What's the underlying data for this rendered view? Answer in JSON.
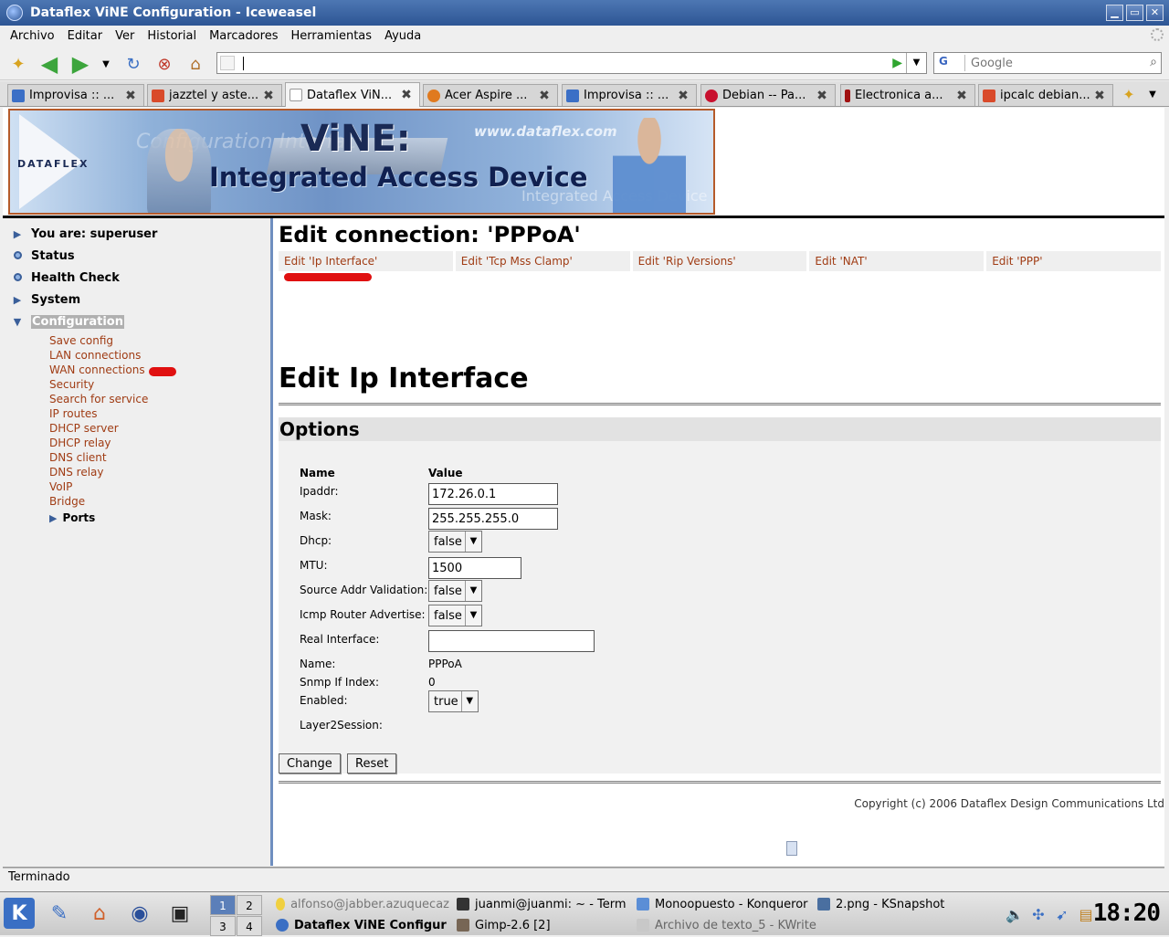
{
  "window": {
    "title": "Dataflex ViNE Configuration - Iceweasel",
    "btn_min": "▁",
    "btn_max": "▭",
    "btn_close": "✕"
  },
  "menu": [
    "Archivo",
    "Editar",
    "Ver",
    "Historial",
    "Marcadores",
    "Herramientas",
    "Ayuda"
  ],
  "toolbar": {
    "url_value": "",
    "search_engine": "G",
    "search_placeholder": "Google"
  },
  "tabs": [
    {
      "label": "Improvisa :: ...",
      "favicon_color": "#3b6fc6",
      "active": false
    },
    {
      "label": "jazztel y aste...",
      "favicon_color": "#d94a2a",
      "active": false
    },
    {
      "label": "Dataflex ViN...",
      "favicon_color": "#ffffff",
      "active": true
    },
    {
      "label": "Acer Aspire ...",
      "favicon_color": "#e07a1f",
      "active": false
    },
    {
      "label": "Improvisa :: ...",
      "favicon_color": "#3b6fc6",
      "active": false
    },
    {
      "label": "Debian -- Pa...",
      "favicon_color": "#c8102e",
      "active": false
    },
    {
      "label": "Electronica a...",
      "favicon_color": "#a01010",
      "active": false
    },
    {
      "label": "ipcalc debian...",
      "favicon_color": "#d94a2a",
      "active": false
    }
  ],
  "banner": {
    "logo": "DATAFLEX",
    "product": "ViNE:",
    "tagline": "Integrated Access Device",
    "url": "www.dataflex.com",
    "ghost1": "Configuration Interface",
    "ghost2": "Integrated Access Device"
  },
  "sidebar": {
    "main": [
      {
        "label": "You are: superuser",
        "marker": "arrow"
      },
      {
        "label": "Status",
        "marker": "dot"
      },
      {
        "label": "Health Check",
        "marker": "dot"
      },
      {
        "label": "System",
        "marker": "arrow"
      },
      {
        "label": "Configuration",
        "marker": "down"
      }
    ],
    "sub": [
      "Save config",
      "LAN connections",
      "WAN connections",
      "Security",
      "Search for service",
      "IP routes",
      "DHCP server",
      "DHCP relay",
      "DNS client",
      "DNS relay",
      "VoIP",
      "Bridge"
    ],
    "ports": "Ports"
  },
  "content": {
    "connection_title": "Edit connection: 'PPPoA'",
    "edit_tabs": [
      "Edit 'Ip Interface'",
      "Edit 'Tcp Mss Clamp'",
      "Edit 'Rip Versions'",
      "Edit 'NAT'",
      "Edit 'PPP'"
    ],
    "section_title": "Edit Ip Interface",
    "options_title": "Options",
    "col_name": "Name",
    "col_value": "Value",
    "fields": {
      "ipaddr_label": "Ipaddr:",
      "ipaddr_value": "172.26.0.1",
      "mask_label": "Mask:",
      "mask_value": "255.255.255.0",
      "dhcp_label": "Dhcp:",
      "dhcp_value": "false",
      "mtu_label": "MTU:",
      "mtu_value": "1500",
      "sav_label": "Source Addr Validation:",
      "sav_value": "false",
      "icmp_label": "Icmp Router Advertise:",
      "icmp_value": "false",
      "real_label": "Real Interface:",
      "real_value": "",
      "name_label": "Name:",
      "name_value": "PPPoA",
      "snmp_label": "Snmp If Index:",
      "snmp_value": "0",
      "enabled_label": "Enabled:",
      "enabled_value": "true",
      "l2_label": "Layer2Session:"
    },
    "change_button": "Change",
    "reset_button": "Reset",
    "copyright": "Copyright (c) 2006 Dataflex Design Communications Ltd"
  },
  "status_text": "Terminado",
  "taskbar": {
    "pager": [
      "1",
      "2",
      "3",
      "4"
    ],
    "tasks_top": [
      "alfonso@jabber.azuquecaz",
      "juanmi@juanmi: ~ - Term",
      "Monoopuesto - Konqueror",
      "2.png - KSnapshot"
    ],
    "tasks_bottom": [
      "Dataflex ViNE Configur",
      "Gimp-2.6 [2]",
      "Archivo de texto_5 - KWrite"
    ],
    "clock": "18:20"
  }
}
